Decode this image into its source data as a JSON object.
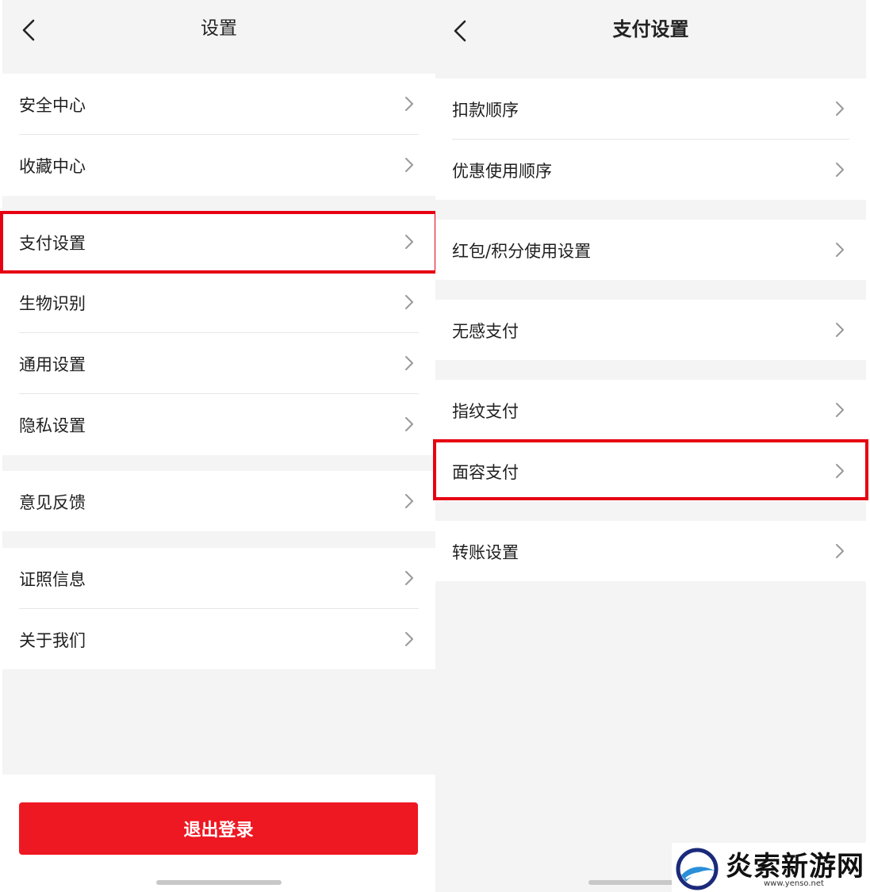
{
  "left": {
    "title": "设置",
    "groups": [
      [
        "安全中心",
        "收藏中心"
      ],
      [
        "支付设置",
        "生物识别",
        "通用设置",
        "隐私设置"
      ],
      [
        "意见反馈"
      ],
      [
        "证照信息",
        "关于我们"
      ]
    ],
    "logout_label": "退出登录"
  },
  "right": {
    "title": "支付设置",
    "groups": [
      [
        "扣款顺序",
        "优惠使用顺序"
      ],
      [
        "红包/积分使用设置"
      ],
      [
        "无感支付"
      ],
      [
        "指纹支付",
        "面容支付"
      ],
      [
        "转账设置"
      ]
    ]
  },
  "watermark": {
    "text": "炎索新游网",
    "url": "www.yenso.net"
  },
  "colors": {
    "highlight": "#e60012",
    "logout_button": "#ee1822",
    "background": "#f4f4f4"
  },
  "icons": {
    "back": "chevron-left-icon",
    "row_arrow": "chevron-right-icon"
  }
}
